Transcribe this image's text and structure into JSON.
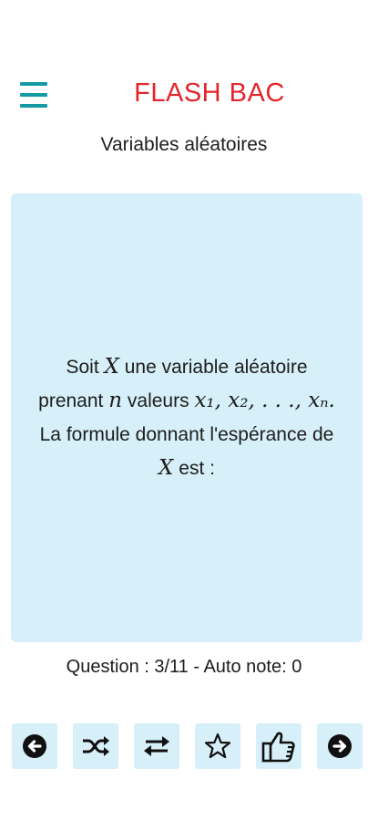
{
  "header": {
    "app_title": "FLASH BAC",
    "menu_icon": "hamburger-menu-icon"
  },
  "section_title": "Variables aléatoires",
  "card": {
    "line1_a": "Soit",
    "line1_var": "X",
    "line1_b": "une variable aléatoire",
    "line2_a": "prenant",
    "line2_var": "n",
    "line2_b": "valeurs",
    "line2_math": "x₁, x₂, . . ., xₙ.",
    "line3": "La formule donnant l'espérance de",
    "line4_var": "X",
    "line4_b": "est :"
  },
  "status": {
    "text": "Question : 3/11 - Auto note: 0"
  },
  "toolbar": {
    "icons": [
      "previous-icon",
      "shuffle-icon",
      "swap-icon",
      "star-icon",
      "thumbs-up-icon",
      "next-icon"
    ]
  },
  "colors": {
    "accent_teal": "#139aa4",
    "title_red": "#e3262b",
    "card_bg": "#d6eff8"
  }
}
